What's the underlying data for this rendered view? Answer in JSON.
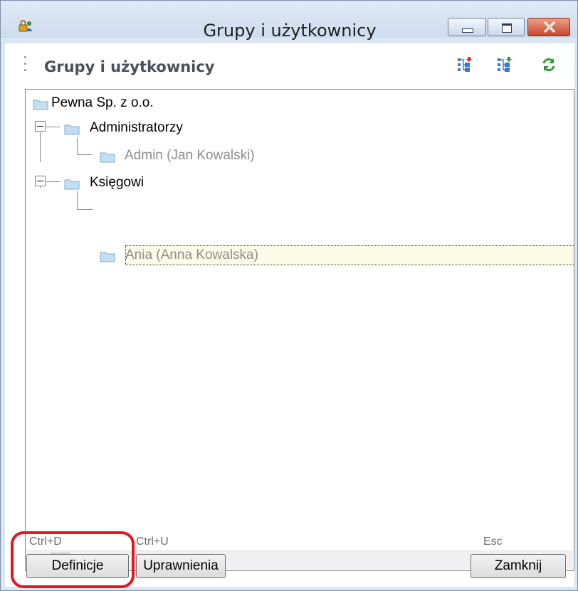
{
  "window": {
    "title": "Grupy i użytkownicy",
    "icon": "users-lock-icon",
    "controls": [
      "minimize-icon",
      "maximize-icon",
      "close-icon"
    ]
  },
  "panel": {
    "title": "Grupy i użytkownicy",
    "toolbar_icons": [
      "add-group-icon",
      "add-user-icon",
      "refresh-icon"
    ]
  },
  "tree": {
    "root": "Pewna Sp. z o.o.",
    "groups": [
      {
        "label": "Administratorzy",
        "users": [
          "Admin (Jan Kowalski)"
        ]
      },
      {
        "label": "Księgowi",
        "users": [
          "Ania (Anna Kowalska)"
        ]
      }
    ],
    "selected": "Ania (Anna Kowalska)"
  },
  "buttons": {
    "definitions": {
      "label": "Definicje",
      "shortcut": "Ctrl+D"
    },
    "permissions": {
      "label": "Uprawnienia",
      "shortcut": "Ctrl+U"
    },
    "close": {
      "label": "Zamknij",
      "shortcut": "Esc"
    }
  },
  "colors": {
    "highlight": "#e8151b",
    "selection_bg": "#fbfbe6",
    "folder": "#c3def1"
  }
}
